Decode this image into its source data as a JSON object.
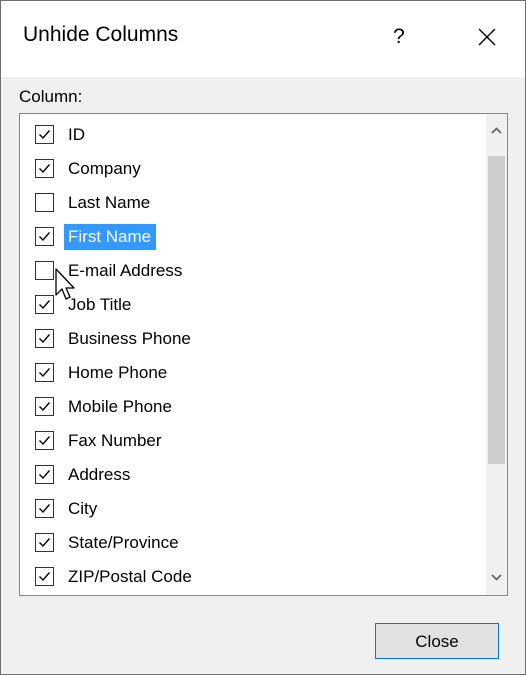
{
  "dialog": {
    "title": "Unhide Columns",
    "help_label": "?",
    "close_icon": "close-icon",
    "column_label": "Column:",
    "close_button_label": "Close"
  },
  "columns": [
    {
      "label": "ID",
      "checked": true,
      "selected": false
    },
    {
      "label": "Company",
      "checked": true,
      "selected": false
    },
    {
      "label": "Last Name",
      "checked": false,
      "selected": false
    },
    {
      "label": "First Name",
      "checked": true,
      "selected": true
    },
    {
      "label": "E-mail Address",
      "checked": false,
      "selected": false
    },
    {
      "label": "Job Title",
      "checked": true,
      "selected": false
    },
    {
      "label": "Business Phone",
      "checked": true,
      "selected": false
    },
    {
      "label": "Home Phone",
      "checked": true,
      "selected": false
    },
    {
      "label": "Mobile Phone",
      "checked": true,
      "selected": false
    },
    {
      "label": "Fax Number",
      "checked": true,
      "selected": false
    },
    {
      "label": "Address",
      "checked": true,
      "selected": false
    },
    {
      "label": "City",
      "checked": true,
      "selected": false
    },
    {
      "label": "State/Province",
      "checked": true,
      "selected": false
    },
    {
      "label": "ZIP/Postal Code",
      "checked": true,
      "selected": false
    }
  ],
  "colors": {
    "selection_background": "#3399ff",
    "button_border": "#0078d7"
  }
}
